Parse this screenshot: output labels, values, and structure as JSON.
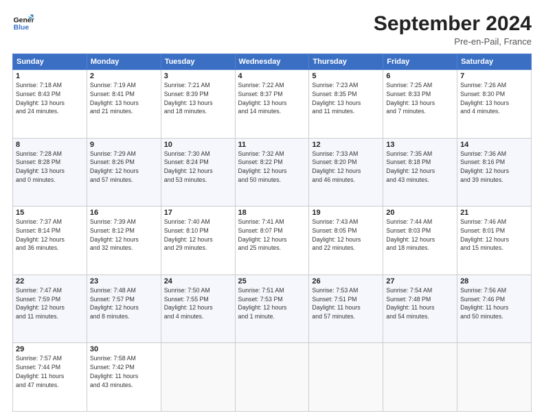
{
  "header": {
    "logo_line1": "General",
    "logo_line2": "Blue",
    "month_title": "September 2024",
    "subtitle": "Pre-en-Pail, France"
  },
  "days_of_week": [
    "Sunday",
    "Monday",
    "Tuesday",
    "Wednesday",
    "Thursday",
    "Friday",
    "Saturday"
  ],
  "weeks": [
    [
      {
        "day": "1",
        "info": "Sunrise: 7:18 AM\nSunset: 8:43 PM\nDaylight: 13 hours\nand 24 minutes."
      },
      {
        "day": "2",
        "info": "Sunrise: 7:19 AM\nSunset: 8:41 PM\nDaylight: 13 hours\nand 21 minutes."
      },
      {
        "day": "3",
        "info": "Sunrise: 7:21 AM\nSunset: 8:39 PM\nDaylight: 13 hours\nand 18 minutes."
      },
      {
        "day": "4",
        "info": "Sunrise: 7:22 AM\nSunset: 8:37 PM\nDaylight: 13 hours\nand 14 minutes."
      },
      {
        "day": "5",
        "info": "Sunrise: 7:23 AM\nSunset: 8:35 PM\nDaylight: 13 hours\nand 11 minutes."
      },
      {
        "day": "6",
        "info": "Sunrise: 7:25 AM\nSunset: 8:33 PM\nDaylight: 13 hours\nand 7 minutes."
      },
      {
        "day": "7",
        "info": "Sunrise: 7:26 AM\nSunset: 8:30 PM\nDaylight: 13 hours\nand 4 minutes."
      }
    ],
    [
      {
        "day": "8",
        "info": "Sunrise: 7:28 AM\nSunset: 8:28 PM\nDaylight: 13 hours\nand 0 minutes."
      },
      {
        "day": "9",
        "info": "Sunrise: 7:29 AM\nSunset: 8:26 PM\nDaylight: 12 hours\nand 57 minutes."
      },
      {
        "day": "10",
        "info": "Sunrise: 7:30 AM\nSunset: 8:24 PM\nDaylight: 12 hours\nand 53 minutes."
      },
      {
        "day": "11",
        "info": "Sunrise: 7:32 AM\nSunset: 8:22 PM\nDaylight: 12 hours\nand 50 minutes."
      },
      {
        "day": "12",
        "info": "Sunrise: 7:33 AM\nSunset: 8:20 PM\nDaylight: 12 hours\nand 46 minutes."
      },
      {
        "day": "13",
        "info": "Sunrise: 7:35 AM\nSunset: 8:18 PM\nDaylight: 12 hours\nand 43 minutes."
      },
      {
        "day": "14",
        "info": "Sunrise: 7:36 AM\nSunset: 8:16 PM\nDaylight: 12 hours\nand 39 minutes."
      }
    ],
    [
      {
        "day": "15",
        "info": "Sunrise: 7:37 AM\nSunset: 8:14 PM\nDaylight: 12 hours\nand 36 minutes."
      },
      {
        "day": "16",
        "info": "Sunrise: 7:39 AM\nSunset: 8:12 PM\nDaylight: 12 hours\nand 32 minutes."
      },
      {
        "day": "17",
        "info": "Sunrise: 7:40 AM\nSunset: 8:10 PM\nDaylight: 12 hours\nand 29 minutes."
      },
      {
        "day": "18",
        "info": "Sunrise: 7:41 AM\nSunset: 8:07 PM\nDaylight: 12 hours\nand 25 minutes."
      },
      {
        "day": "19",
        "info": "Sunrise: 7:43 AM\nSunset: 8:05 PM\nDaylight: 12 hours\nand 22 minutes."
      },
      {
        "day": "20",
        "info": "Sunrise: 7:44 AM\nSunset: 8:03 PM\nDaylight: 12 hours\nand 18 minutes."
      },
      {
        "day": "21",
        "info": "Sunrise: 7:46 AM\nSunset: 8:01 PM\nDaylight: 12 hours\nand 15 minutes."
      }
    ],
    [
      {
        "day": "22",
        "info": "Sunrise: 7:47 AM\nSunset: 7:59 PM\nDaylight: 12 hours\nand 11 minutes."
      },
      {
        "day": "23",
        "info": "Sunrise: 7:48 AM\nSunset: 7:57 PM\nDaylight: 12 hours\nand 8 minutes."
      },
      {
        "day": "24",
        "info": "Sunrise: 7:50 AM\nSunset: 7:55 PM\nDaylight: 12 hours\nand 4 minutes."
      },
      {
        "day": "25",
        "info": "Sunrise: 7:51 AM\nSunset: 7:53 PM\nDaylight: 12 hours\nand 1 minute."
      },
      {
        "day": "26",
        "info": "Sunrise: 7:53 AM\nSunset: 7:51 PM\nDaylight: 11 hours\nand 57 minutes."
      },
      {
        "day": "27",
        "info": "Sunrise: 7:54 AM\nSunset: 7:48 PM\nDaylight: 11 hours\nand 54 minutes."
      },
      {
        "day": "28",
        "info": "Sunrise: 7:56 AM\nSunset: 7:46 PM\nDaylight: 11 hours\nand 50 minutes."
      }
    ],
    [
      {
        "day": "29",
        "info": "Sunrise: 7:57 AM\nSunset: 7:44 PM\nDaylight: 11 hours\nand 47 minutes."
      },
      {
        "day": "30",
        "info": "Sunrise: 7:58 AM\nSunset: 7:42 PM\nDaylight: 11 hours\nand 43 minutes."
      },
      {
        "day": "",
        "info": ""
      },
      {
        "day": "",
        "info": ""
      },
      {
        "day": "",
        "info": ""
      },
      {
        "day": "",
        "info": ""
      },
      {
        "day": "",
        "info": ""
      }
    ]
  ]
}
